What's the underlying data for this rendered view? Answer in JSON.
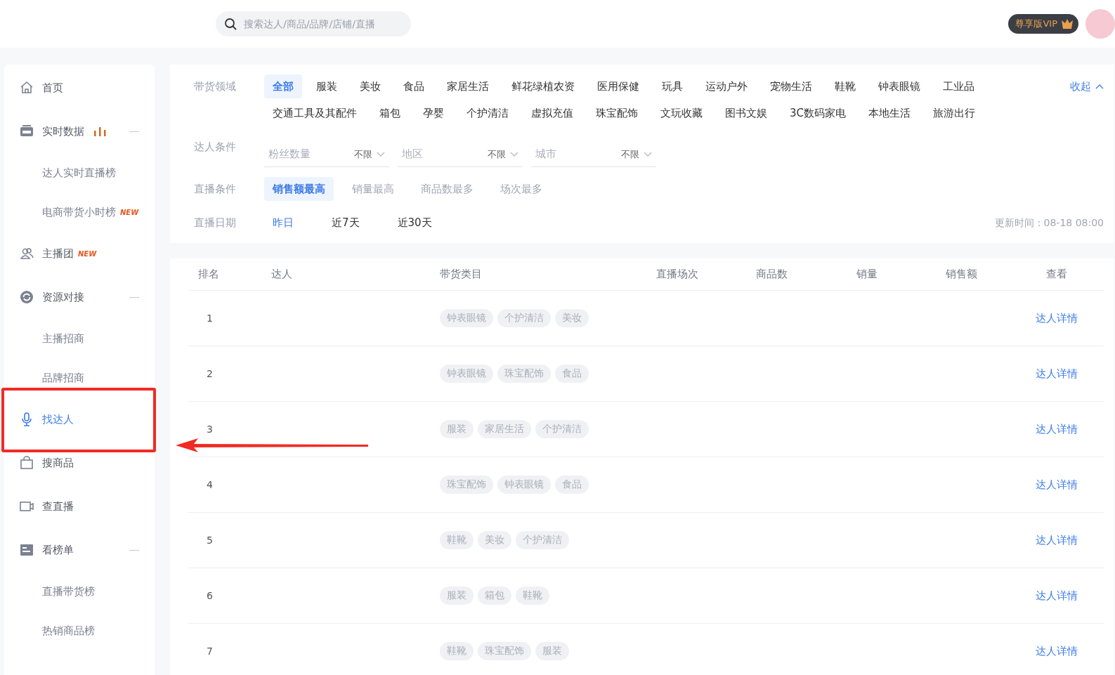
{
  "topbar": {
    "search": {
      "placeholder": "搜索达人/商品/品牌/店铺/直播"
    },
    "vip_badge": "尊享版VIP"
  },
  "sidebar": {
    "items": [
      {
        "kind": "main",
        "label": "首页",
        "selected": false
      },
      {
        "kind": "group",
        "label": "实时数据",
        "selected": false,
        "expanded": true
      },
      {
        "kind": "sub",
        "label": "达人实时直播榜",
        "selected": false
      },
      {
        "kind": "sub",
        "label": "电商带货小时榜",
        "selected": false,
        "badge": "NEW"
      },
      {
        "kind": "main",
        "label": "主播团",
        "selected": false,
        "badge": "NEW"
      },
      {
        "kind": "group",
        "label": "资源对接",
        "selected": false,
        "expanded": true
      },
      {
        "kind": "sub",
        "label": "主播招商",
        "selected": false
      },
      {
        "kind": "sub",
        "label": "品牌招商",
        "selected": false
      },
      {
        "kind": "main",
        "label": "找达人",
        "selected": true
      },
      {
        "kind": "main",
        "label": "搜商品",
        "selected": false
      },
      {
        "kind": "main",
        "label": "查直播",
        "selected": false
      },
      {
        "kind": "group",
        "label": "看榜单",
        "selected": false,
        "expanded": true
      },
      {
        "kind": "sub",
        "label": "直播带货榜",
        "selected": false
      },
      {
        "kind": "sub",
        "label": "热销商品榜",
        "selected": false
      }
    ]
  },
  "filters": {
    "category": {
      "label": "带货领域",
      "collapse_link": "收起",
      "options": [
        {
          "label": "全部",
          "selected": true
        },
        {
          "label": "服装",
          "selected": false
        },
        {
          "label": "美妆",
          "selected": false
        },
        {
          "label": "食品",
          "selected": false
        },
        {
          "label": "家居生活",
          "selected": false
        },
        {
          "label": "鲜花绿植农资",
          "selected": false
        },
        {
          "label": "医用保健",
          "selected": false
        },
        {
          "label": "玩具",
          "selected": false
        },
        {
          "label": "运动户外",
          "selected": false
        },
        {
          "label": "宠物生活",
          "selected": false
        },
        {
          "label": "鞋靴",
          "selected": false
        },
        {
          "label": "钟表眼镜",
          "selected": false
        },
        {
          "label": "工业品",
          "selected": false
        },
        {
          "label": "交通工具及其配件",
          "selected": false
        },
        {
          "label": "箱包",
          "selected": false
        },
        {
          "label": "孕婴",
          "selected": false
        },
        {
          "label": "个护清洁",
          "selected": false
        },
        {
          "label": "虚拟充值",
          "selected": false
        },
        {
          "label": "珠宝配饰",
          "selected": false
        },
        {
          "label": "文玩收藏",
          "selected": false
        },
        {
          "label": "图书文娱",
          "selected": false
        },
        {
          "label": "3C数码家电",
          "selected": false
        },
        {
          "label": "本地生活",
          "selected": false
        },
        {
          "label": "旅游出行",
          "selected": false
        }
      ]
    },
    "creator": {
      "label": "达人条件",
      "dropdowns": [
        {
          "placeholder": "粉丝数量",
          "value": "不限"
        },
        {
          "placeholder": "地区",
          "value": "不限"
        },
        {
          "placeholder": "城市",
          "value": "不限"
        }
      ]
    },
    "live": {
      "label": "直播条件",
      "options": [
        {
          "label": "销售额最高",
          "selected": true
        },
        {
          "label": "销量最高",
          "selected": false
        },
        {
          "label": "商品数最多",
          "selected": false
        },
        {
          "label": "场次最多",
          "selected": false
        }
      ]
    },
    "date": {
      "label": "直播日期",
      "options": [
        {
          "label": "昨日",
          "selected": true
        },
        {
          "label": "近7天",
          "selected": false
        },
        {
          "label": "近30天",
          "selected": false
        }
      ],
      "update_time": "更新时间：08-18 08:00"
    }
  },
  "table": {
    "columns": [
      "排名",
      "达人",
      "带货类目",
      "直播场次",
      "商品数",
      "销量",
      "销售额",
      "查看"
    ],
    "rows": [
      {
        "rank": "1",
        "categories": [
          "钟表眼镜",
          "个护清洁",
          "美妆"
        ],
        "link": "达人详情"
      },
      {
        "rank": "2",
        "categories": [
          "钟表眼镜",
          "珠宝配饰",
          "食品"
        ],
        "link": "达人详情"
      },
      {
        "rank": "3",
        "categories": [
          "服装",
          "家居生活",
          "个护清洁"
        ],
        "link": "达人详情"
      },
      {
        "rank": "4",
        "categories": [
          "珠宝配饰",
          "钟表眼镜",
          "食品"
        ],
        "link": "达人详情"
      },
      {
        "rank": "5",
        "categories": [
          "鞋靴",
          "美妆",
          "个护清洁"
        ],
        "link": "达人详情"
      },
      {
        "rank": "6",
        "categories": [
          "服装",
          "箱包",
          "鞋靴"
        ],
        "link": "达人详情"
      },
      {
        "rank": "7",
        "categories": [
          "鞋靴",
          "珠宝配饰",
          "服装"
        ],
        "link": "达人详情"
      }
    ]
  }
}
